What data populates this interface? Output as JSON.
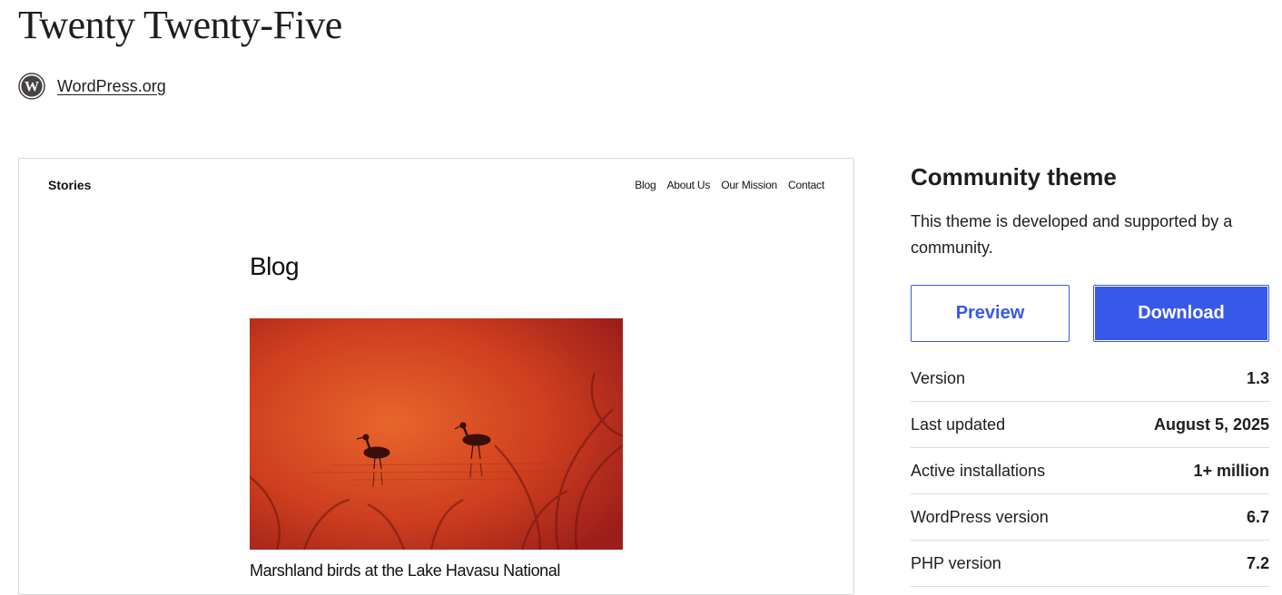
{
  "header": {
    "title": "Twenty Twenty-Five",
    "author_link": "WordPress.org",
    "author_icon": "wordpress-logo-icon"
  },
  "preview": {
    "site_title": "Stories",
    "nav": [
      "Blog",
      "About Us",
      "Our Mission",
      "Contact"
    ],
    "heading": "Blog",
    "post_title": "Marshland birds at the Lake Havasu National"
  },
  "sidebar": {
    "heading": "Community theme",
    "description": "This theme is developed and supported by a community.",
    "preview_button": "Preview",
    "download_button": "Download",
    "accent_color": "#3858e9",
    "meta": [
      {
        "label": "Version",
        "value": "1.3"
      },
      {
        "label": "Last updated",
        "value": "August 5, 2025"
      },
      {
        "label": "Active installations",
        "value": "1+ million"
      },
      {
        "label": "WordPress version",
        "value": "6.7"
      },
      {
        "label": "PHP version",
        "value": "7.2"
      }
    ]
  }
}
